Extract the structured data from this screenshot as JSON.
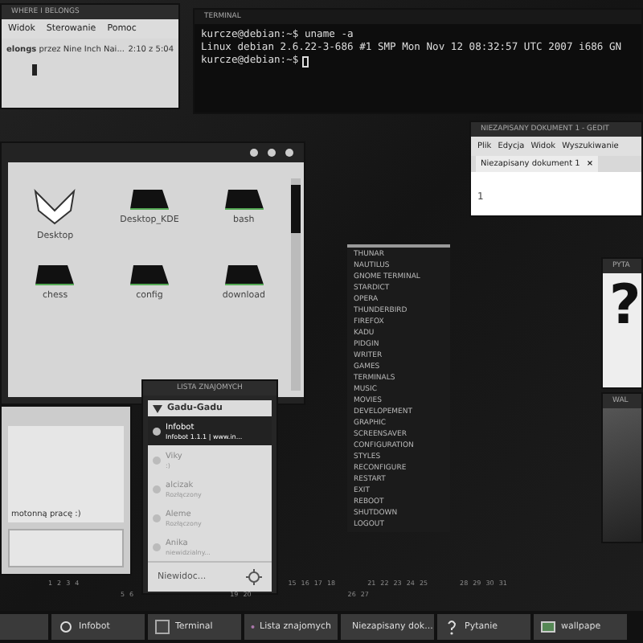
{
  "music_player": {
    "title": "WHERE I BELONGS",
    "menu": [
      "Widok",
      "Sterowanie",
      "Pomoc"
    ],
    "track": "**elongs** przez Nine Inch Nai...",
    "time": "2:10 z 5:04",
    "level": 0.15
  },
  "terminal": {
    "title": "TERMINAL",
    "lines": [
      "kurcze@debian:~$ uname -a",
      "Linux debian 2.6.22-3-686 #1 SMP Mon Nov 12 08:32:57 UTC 2007 i686 GN",
      "kurcze@debian:~$"
    ]
  },
  "file_manager": {
    "items": [
      {
        "label": "Desktop",
        "kind": "logo"
      },
      {
        "label": "Desktop_KDE",
        "kind": "folder"
      },
      {
        "label": "bash",
        "kind": "folder"
      },
      {
        "label": "chess",
        "kind": "folder"
      },
      {
        "label": "config",
        "kind": "folder"
      },
      {
        "label": "download",
        "kind": "folder"
      }
    ]
  },
  "chat": {
    "message": "motonną pracę :)"
  },
  "contact_list": {
    "title": "LISTA ZNAJOMYCH",
    "group": "Gadu-Gadu",
    "contacts": [
      {
        "name": "Infobot",
        "status": "Infobot 1.1.1 | www.in...",
        "selected": true
      },
      {
        "name": "Viky",
        "status": ":)",
        "selected": false
      },
      {
        "name": "alcizak",
        "status": "Rozłączony",
        "selected": false
      },
      {
        "name": "Aleme",
        "status": "Rozłączony",
        "selected": false
      },
      {
        "name": "Anika",
        "status": "niewidzialny...",
        "selected": false
      }
    ],
    "presence": "Niewidoc..."
  },
  "app_menu": {
    "items": [
      "THUNAR",
      "NAUTILUS",
      "GNOME TERMINAL",
      "STARDICT",
      "OPERA",
      "THUNDERBIRD",
      "FIREFOX",
      "KADU",
      "PIDGIN",
      "WRITER",
      "GAMES",
      "TERMINALS",
      "MUSIC",
      "MOVIES",
      "DEVELOPEMENT",
      "GRAPHIC",
      "SCREENSAVER",
      "CONFIGURATION",
      "STYLES",
      "RECONFIGURE",
      "RESTART",
      "EXIT",
      "REBOOT",
      "SHUTDOWN",
      "LOGOUT"
    ]
  },
  "editor": {
    "title": "NIEZAPISANY DOKUMENT 1 - GEDIT",
    "menu": [
      "Plik",
      "Edycja",
      "Widok",
      "Wyszukiwanie"
    ],
    "tab": "Niezapisany dokument 1",
    "tab_close": "×",
    "line_numbers": [
      "1"
    ]
  },
  "question_window": {
    "title": "PYTA",
    "symbol": "?"
  },
  "wallpaper_window": {
    "title": "WAL"
  },
  "calendar": {
    "rows": [
      [
        [
          "1",
          "2",
          "3",
          "4"
        ],
        [
          "15",
          "16",
          "17",
          "18"
        ],
        [
          "21",
          "22",
          "23",
          "24",
          "25"
        ],
        [
          "28",
          "29",
          "30",
          "31"
        ]
      ],
      [
        [
          "5",
          "6"
        ],
        [
          "19",
          "20"
        ],
        [
          "26",
          "27"
        ]
      ]
    ]
  },
  "taskbar": {
    "items": [
      {
        "label": "Infobot",
        "kind": "bot"
      },
      {
        "label": "Terminal",
        "kind": "terminal"
      },
      {
        "label": "Lista znajomych",
        "kind": "contacts"
      },
      {
        "label": "Niezapisany dok...",
        "kind": "editor"
      },
      {
        "label": "Pytanie",
        "kind": "question"
      },
      {
        "label": "wallpape",
        "kind": "image"
      }
    ]
  }
}
